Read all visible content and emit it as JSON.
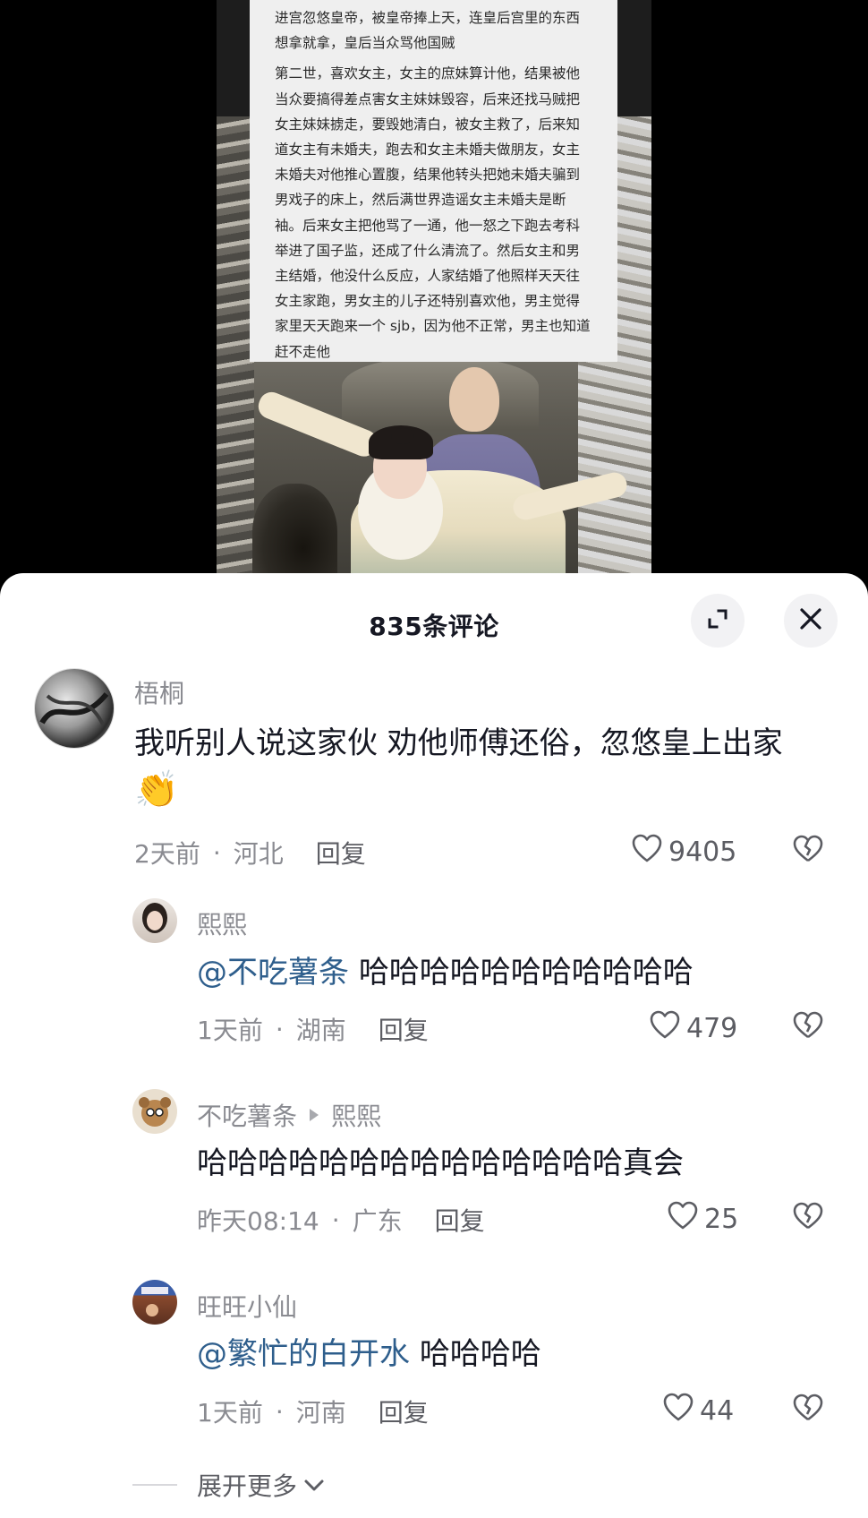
{
  "video": {
    "overlay_paragraphs": [
      "进宫忽悠皇帝，被皇帝捧上天，连皇后宫里的东西想拿就拿，皇后当众骂他国贼",
      "第二世，喜欢女主，女主的庶妹算计他，结果被他当众要搞得差点害女主妹妹毁容，后来还找马贼把女主妹妹掳走，要毁她清白，被女主救了，后来知道女主有未婚夫，跑去和女主未婚夫做朋友，女主未婚夫对他推心置腹，结果他转头把她未婚夫骗到男戏子的床上，然后满世界造谣女主未婚夫是断袖。后来女主把他骂了一通，他一怒之下跑去考科举进了国子监，还成了什么清流了。然后女主和男主结婚，他没什么反应，人家结婚了他照样天天往女主家跑，男女主的儿子还特别喜欢他，男主觉得家里天天跑来一个 sjb，因为他不正常，男主也知道赶不走他"
    ]
  },
  "panel": {
    "title": "835条评论",
    "expand_icon": "expand-icon",
    "close_icon": "close-icon"
  },
  "comments": [
    {
      "avatar": "ink-painting-avatar",
      "name": "梧桐",
      "text": "我听别人说这家伙 劝他师傅还俗，忽悠皇上出家",
      "emoji": "👏",
      "time": "2天前",
      "location": "河北",
      "reply": "回复",
      "likes": "9405"
    },
    {
      "avatar": "girl-photo-avatar",
      "name": "熙熙",
      "mention": "@不吃薯条",
      "text": "哈哈哈哈哈哈哈哈哈哈哈",
      "time": "1天前",
      "location": "湖南",
      "reply": "回复",
      "likes": "479"
    },
    {
      "avatar": "bear-avatar",
      "name": "不吃薯条",
      "reply_to": "熙熙",
      "text": "哈哈哈哈哈哈哈哈哈哈哈哈哈哈真会",
      "time": "昨天08:14",
      "location": "广东",
      "reply": "回复",
      "likes": "25"
    },
    {
      "avatar": "street-photo-avatar",
      "name": "旺旺小仙",
      "mention": "@繁忙的白开水",
      "text": "哈哈哈哈",
      "time": "1天前",
      "location": "河南",
      "reply": "回复",
      "likes": "44"
    }
  ],
  "footer": {
    "expand_more": "展开更多"
  },
  "colors": {
    "mention": "#2e5e8c",
    "meta": "#8a8b91",
    "text": "#161823"
  }
}
